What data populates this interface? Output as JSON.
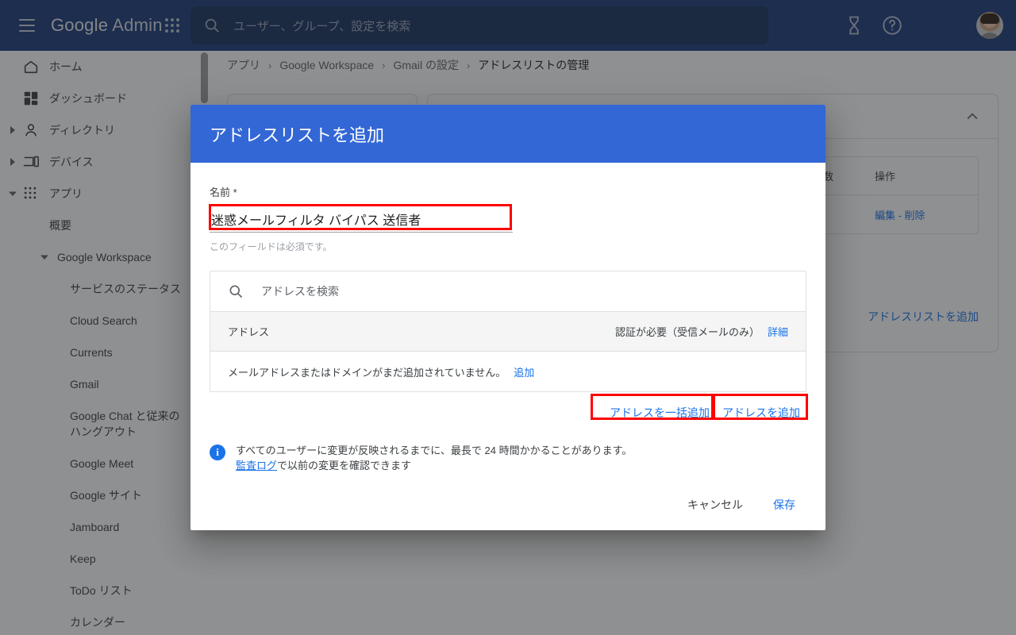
{
  "appbar": {
    "menu_icon": "hamburger-icon",
    "brand_google": "Google",
    "brand_admin": "Admin",
    "search": {
      "placeholder": "ユーザー、グループ、設定を検索",
      "icon": "search-icon"
    },
    "icons": [
      {
        "name": "hourglass-icon",
        "label": ""
      },
      {
        "name": "help-icon",
        "label": ""
      },
      {
        "name": "apps-grid-icon",
        "label": ""
      },
      {
        "name": "avatar",
        "label": ""
      }
    ],
    "bg_color": "#1a3a7a",
    "search_bg_color": "#16305f"
  },
  "sidebar": {
    "items": [
      {
        "label": "ホーム",
        "icon": "home-icon",
        "expandable": false
      },
      {
        "label": "ダッシュボード",
        "icon": "dashboard-icon",
        "expandable": false
      },
      {
        "label": "ディレクトリ",
        "icon": "person-icon",
        "expandable": true,
        "expanded": false
      },
      {
        "label": "デバイス",
        "icon": "device-icon",
        "expandable": true,
        "expanded": false
      },
      {
        "label": "アプリ",
        "icon": "apps-grid-icon",
        "expandable": true,
        "expanded": true
      }
    ],
    "sub_items": [
      {
        "label": "概要",
        "level": 1
      },
      {
        "label": "Google Workspace",
        "level": 2,
        "expanded": true
      },
      {
        "label": "サービスのステータス",
        "level": 3
      },
      {
        "label": "Cloud Search",
        "level": 3
      },
      {
        "label": "Currents",
        "level": 3
      },
      {
        "label": "Gmail",
        "level": 3
      },
      {
        "label": "Google Chat と従来のハングアウト",
        "level": 3,
        "two_line": true
      },
      {
        "label": "Google Meet",
        "level": 3
      },
      {
        "label": "Google サイト",
        "level": 3
      },
      {
        "label": "Jamboard",
        "level": 3
      },
      {
        "label": "Keep",
        "level": 3
      },
      {
        "label": "ToDo リスト",
        "level": 3
      },
      {
        "label": "カレンダー",
        "level": 3
      }
    ]
  },
  "breadcrumb": {
    "items": [
      "アプリ",
      "Google Workspace",
      "Gmail の設定",
      "アドレスリストの管理"
    ],
    "separator": "›"
  },
  "background_card": {
    "collapse_icon": "chevron-up-icon",
    "table": {
      "headers": [
        "",
        "アドレスの数",
        "操作"
      ],
      "rows": [
        {
          "count": "",
          "actions": "編集 - 削除"
        }
      ]
    },
    "add_list_link": "アドレスリストを追加",
    "note": "最長で 24 時間かかることがあり"
  },
  "dialog": {
    "title": "アドレスリストを追加",
    "header_color": "#3367d6",
    "name_label": "名前 *",
    "name_value": "迷惑メールフィルタ バイパス 送信者",
    "name_hint": "このフィールドは必須です。",
    "address_search_placeholder": "アドレスを検索",
    "address_search_icon": "search-icon",
    "table_header_address": "アドレス",
    "table_header_auth": "認証が必要（受信メールのみ）",
    "table_header_auth_link": "詳細",
    "empty_text": "メールアドレスまたはドメインがまだ追加されていません。",
    "empty_link": "追加",
    "bulk_add_button": "アドレスを一括追加",
    "add_button": "アドレスを追加",
    "info_icon": "info-icon",
    "info_text": "すべてのユーザーに変更が反映されるまでに、最長で 24 時間かかることがあります。",
    "info_link": "監査ログ",
    "info_text_after": "で以前の変更を確認できます",
    "cancel_button": "キャンセル",
    "save_button": "保存"
  },
  "annotations": {
    "highlight_color": "#ff0000",
    "boxes": [
      "name-input",
      "bulk-add-button",
      "add-button"
    ]
  }
}
